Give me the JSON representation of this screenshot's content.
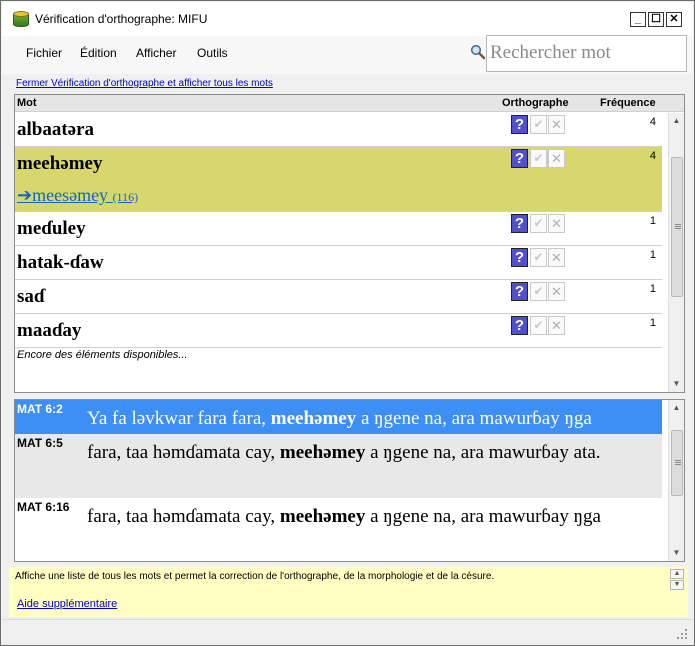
{
  "window": {
    "title": "Vérification d'orthographe: MIFU"
  },
  "menu": {
    "items": [
      "Fichier",
      "Édition",
      "Afficher",
      "Outils"
    ]
  },
  "search": {
    "placeholder": "Rechercher mot"
  },
  "top_link": "Fermer Vérification d'orthographe et afficher tous les mots",
  "wordlist": {
    "columns": {
      "word": "Mot",
      "spelling": "Orthographe",
      "frequency": "Fréquence"
    },
    "rows": [
      {
        "word": "albaatəra",
        "frequency": "4"
      },
      {
        "word": "meehəmey",
        "frequency": "4",
        "selected": true,
        "suggestion": "meesəmey",
        "suggestion_count": "(116)"
      },
      {
        "word": "meɗuley",
        "frequency": "1"
      },
      {
        "word": "hatak-ɗaw",
        "frequency": "1"
      },
      {
        "word": "saɗ",
        "frequency": "1"
      },
      {
        "word": "maaɗay",
        "frequency": "1"
      }
    ],
    "more_text": "Encore des éléments disponibles...",
    "buttons": {
      "question": "?",
      "check": "✔",
      "reject": "✕"
    }
  },
  "context": {
    "rows": [
      {
        "ref": "MAT 6:2",
        "before": "Ya fa ləvkwar fara fara, ",
        "match": "meehəmey",
        "after": " a ŋgene na, ara mawurɓay ŋga"
      },
      {
        "ref": "MAT 6:5",
        "before": "fara, taa həmɗamata cay, ",
        "match": "meehəmey",
        "after": " a ŋgene na, ara mawurɓay ata."
      },
      {
        "ref": "MAT 6:16",
        "before": "fara, taa həmɗamata cay, ",
        "match": "meehəmey",
        "after": " a ŋgene na, ara mawurɓay ŋga"
      }
    ]
  },
  "help": {
    "text": "Affiche une liste de tous les mots et permet la correction de l'orthographe, de la morphologie et de la césure.",
    "link": "Aide supplémentaire"
  },
  "colors": {
    "selected_row": "#d7d76e",
    "selected_context": "#3d8ef5",
    "help_bg": "#ffffc4",
    "link": "#0000cc"
  }
}
